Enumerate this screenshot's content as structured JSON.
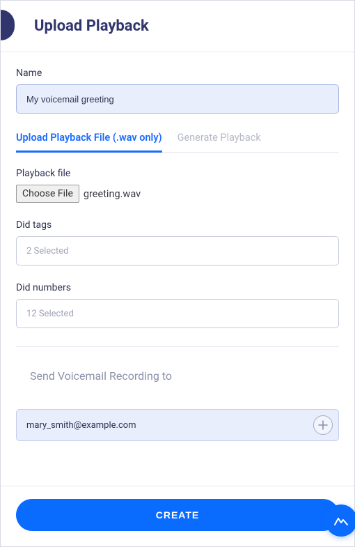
{
  "header": {
    "title": "Upload Playback"
  },
  "form": {
    "name": {
      "label": "Name",
      "value": "My voicemail greeting"
    },
    "tabs": {
      "upload": {
        "label": "Upload Playback File (.wav only)"
      },
      "generate": {
        "label": "Generate Playback"
      }
    },
    "playback_file": {
      "label": "Playback file",
      "button": "Choose File",
      "filename": "greeting.wav"
    },
    "did_tags": {
      "label": "Did tags",
      "value": "2 Selected"
    },
    "did_numbers": {
      "label": "Did numbers",
      "value": "12 Selected"
    },
    "send_to": {
      "title": "Send Voicemail Recording to",
      "email": "mary_smith@example.com"
    }
  },
  "footer": {
    "create": "CREATE"
  }
}
